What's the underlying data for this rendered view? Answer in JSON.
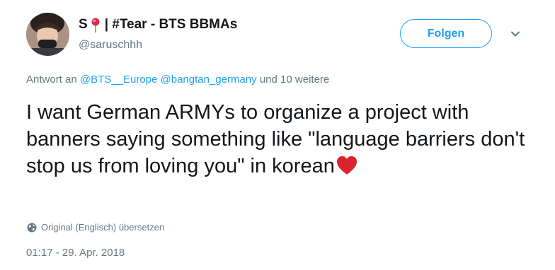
{
  "user": {
    "display_name": "S",
    "display_name_suffix": "| #Tear - BTS BBMAs",
    "screen_name": "@saruschhh"
  },
  "follow_button": {
    "label": "Folgen"
  },
  "reply_context": {
    "prefix": "Antwort an",
    "mentions": [
      "@BTS__Europe",
      "@bangtan_germany"
    ],
    "suffix": "und 10 weitere"
  },
  "tweet": {
    "text": "I want German ARMYs to organize a project with banners saying something like \"language barriers don't stop us from loving you\" in korean"
  },
  "translate": {
    "label": "Original (Englisch) übersetzen"
  },
  "timestamp": "01:17 - 29. Apr. 2018",
  "icons": {
    "pin": "round-pushpin-emoji",
    "heart": "red-heart-emoji",
    "caret": "chevron-down-icon",
    "globe": "globe-icon"
  },
  "colors": {
    "accent": "#1da1f2",
    "secondary_text": "#657786",
    "heart": "#d9232e"
  }
}
